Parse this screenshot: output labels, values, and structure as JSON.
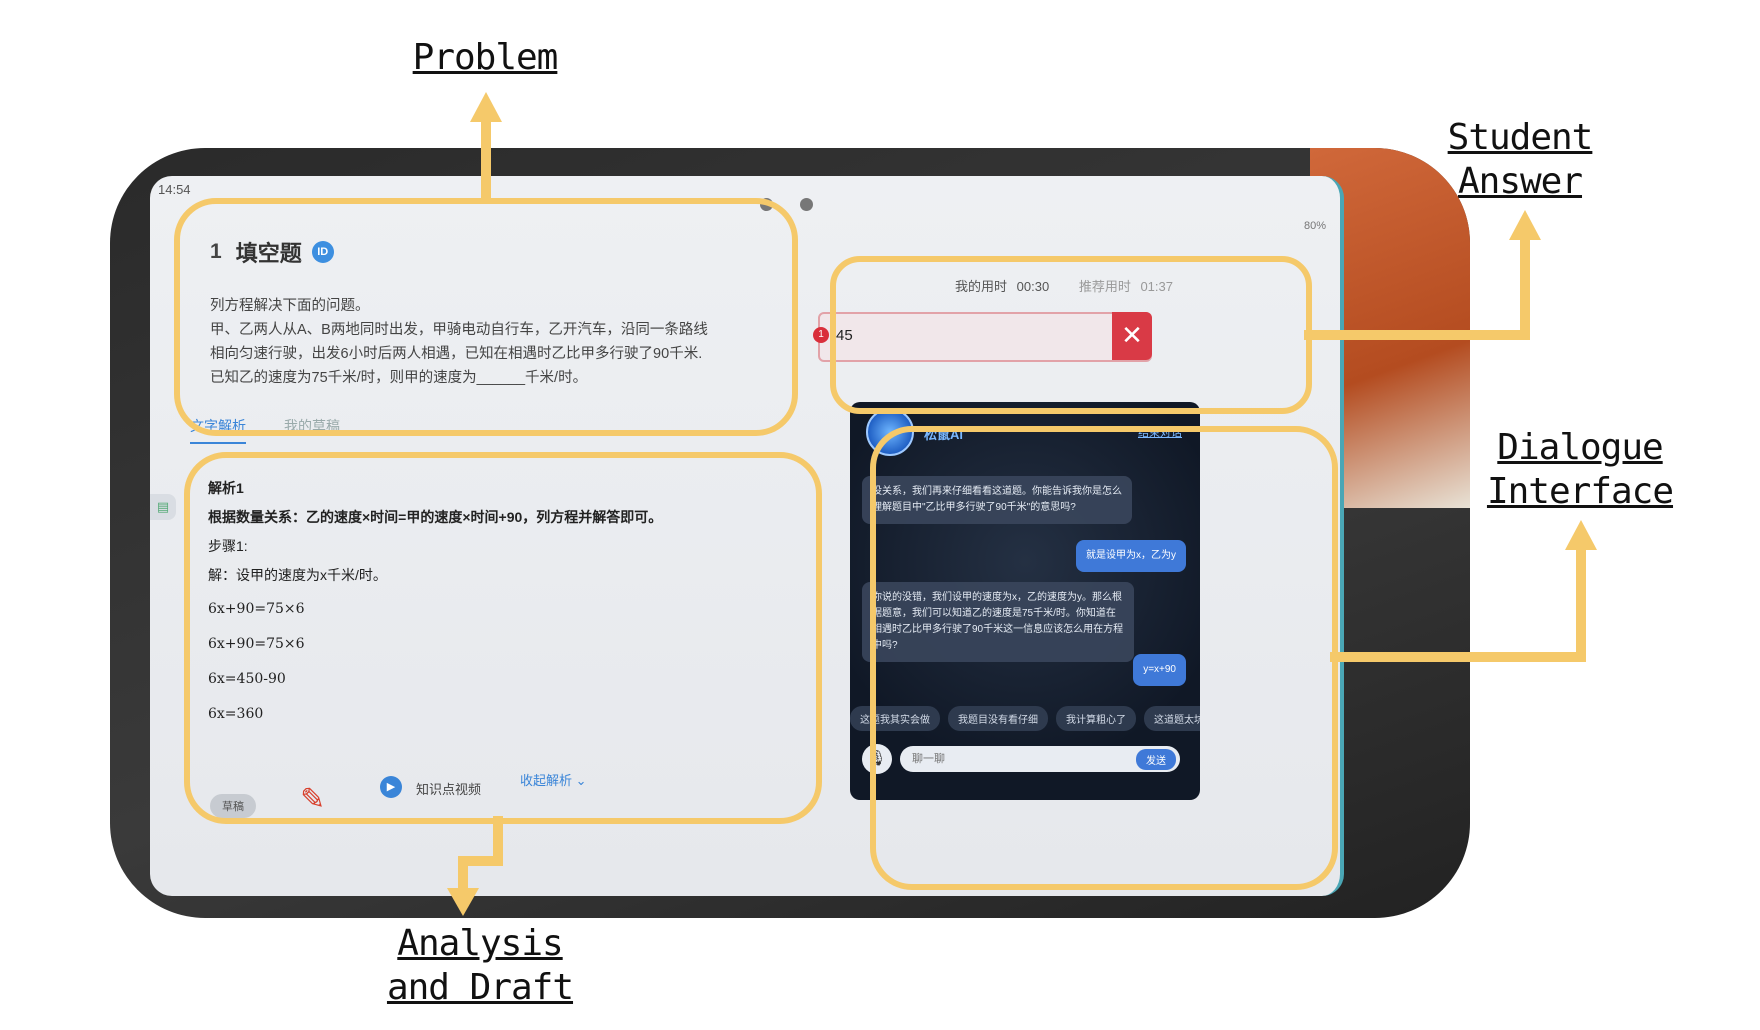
{
  "callouts": {
    "problem": "Problem",
    "student_answer_1": "Student",
    "student_answer_2": "Answer",
    "dialogue_1": "Dialogue",
    "dialogue_2": "Interface",
    "analysis_1": "Analysis",
    "analysis_2": "and Draft"
  },
  "status": {
    "time": "14:54",
    "battery": "80%"
  },
  "problem": {
    "number": "1",
    "type": "填空题",
    "badge": "ID",
    "line1": "列方程解决下面的问题。",
    "line2": "甲、乙两人从A、B两地同时出发，甲骑电动自行车，乙开汽车，沿同一条路线",
    "line3": "相向匀速行驶，出发6小时后两人相遇，已知在相遇时乙比甲多行驶了90千米.",
    "line4": "已知乙的速度为75千米/时，则甲的速度为______千米/时。"
  },
  "timer": {
    "my_label": "我的用时",
    "my_value": "00:30",
    "rec_label": "推荐用时",
    "rec_value": "01:37"
  },
  "answer": {
    "index": "1",
    "value": "45"
  },
  "analysis": {
    "tab_text": "文字解析",
    "tab_draft": "我的草稿",
    "heading": "解析1",
    "relation": "根据数量关系：乙的速度×时间=甲的速度×时间+90，列方程并解答即可。",
    "step": "步骤1:",
    "solve": "解：设甲的速度为x千米/时。",
    "eq1": "6x+90=75×6",
    "eq2": "6x+90=75×6",
    "eq3": "6x=450-90",
    "eq4": "6x=360"
  },
  "bottom": {
    "draft": "草稿",
    "video": "知识点视频",
    "collapse": "收起解析"
  },
  "chat": {
    "name": "松鼠Ai",
    "end": "结束对话",
    "msg1": "没关系，我们再来仔细看看这道题。你能告诉我你是怎么理解题目中\"乙比甲多行驶了90千米\"的意思吗?",
    "msg2": "就是设甲为x，乙为y",
    "msg3": "你说的没错，我们设甲的速度为x，乙的速度为y。那么根据题意，我们可以知道乙的速度是75千米/时。你知道在相遇时乙比甲多行驶了90千米这一信息应该怎么用在方程中吗?",
    "msg4": "y=x+90",
    "quick": [
      "这题我其实会做",
      "我题目没有看仔细",
      "我计算粗心了",
      "这道题太坑了"
    ],
    "placeholder": "聊一聊",
    "send": "发送"
  },
  "colors": {
    "highlight": "#f5c96a",
    "accent": "#3a85d8",
    "error": "#d93a46"
  }
}
